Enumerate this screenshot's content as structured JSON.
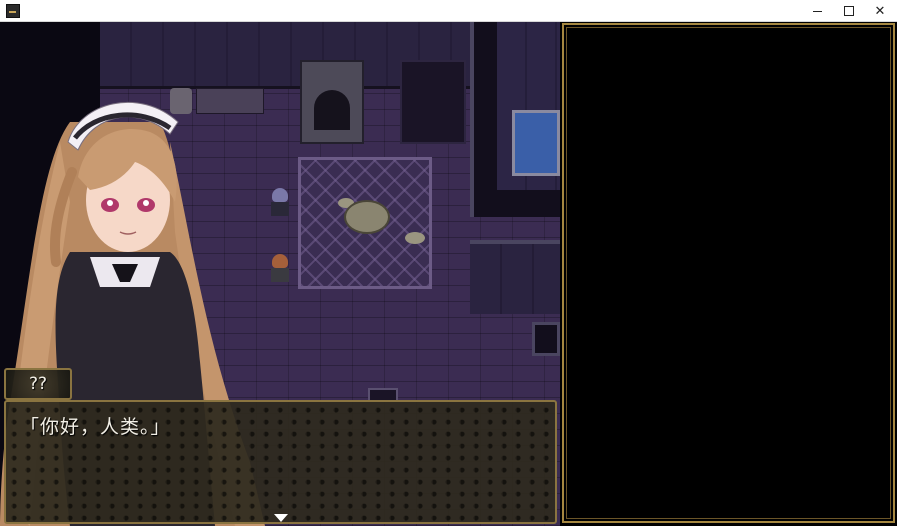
{
  "window": {
    "minimize_glyph": "",
    "maximize_glyph": "",
    "close_glyph": "✕"
  },
  "dialogue": {
    "speaker": "??",
    "text": "「你好，人类。」"
  },
  "colors": {
    "frame_gold": "#a58740",
    "message_bg": "#2e2a1e",
    "text": "#f2efe6"
  },
  "icons": {
    "app": "game-app-icon",
    "next": "triangle-down-icon"
  }
}
